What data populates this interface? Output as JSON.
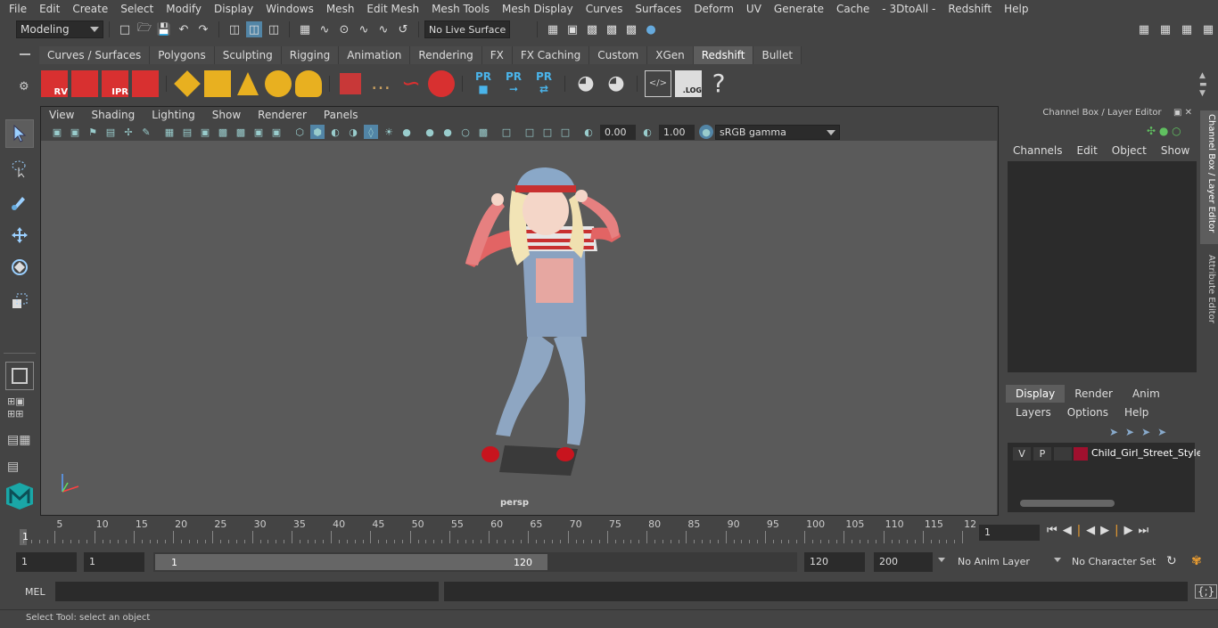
{
  "menu": [
    "File",
    "Edit",
    "Create",
    "Select",
    "Modify",
    "Display",
    "Windows",
    "Mesh",
    "Edit Mesh",
    "Mesh Tools",
    "Mesh Display",
    "Curves",
    "Surfaces",
    "Deform",
    "UV",
    "Generate",
    "Cache",
    "- 3DtoAll -",
    "Redshift",
    "Help"
  ],
  "status": {
    "mode": "Modeling",
    "live_surface": "No Live Surface"
  },
  "shelf": {
    "tabs": [
      "Curves / Surfaces",
      "Polygons",
      "Sculpting",
      "Rigging",
      "Animation",
      "Rendering",
      "FX",
      "FX Caching",
      "Custom",
      "XGen",
      "Redshift",
      "Bullet"
    ],
    "active_tab": "Redshift",
    "icons": {
      "rv": "RV",
      "ipr": "IPR",
      "pr1": "PR",
      "pr2": "PR",
      "pr3": "PR",
      "log": ".LOG",
      "help": "?"
    }
  },
  "viewport": {
    "menu": [
      "View",
      "Shading",
      "Lighting",
      "Show",
      "Renderer",
      "Panels"
    ],
    "exposure": "0.00",
    "gamma": "1.00",
    "color_space": "sRGB gamma",
    "camera_label": "persp"
  },
  "channel_box": {
    "title": "Channel Box / Layer Editor",
    "menu": [
      "Channels",
      "Edit",
      "Object",
      "Show"
    ],
    "layer_tabs": [
      "Display",
      "Render",
      "Anim"
    ],
    "active_layer_tab": "Display",
    "layer_menu": [
      "Layers",
      "Options",
      "Help"
    ],
    "layer": {
      "v": "V",
      "p": "P",
      "name": "Child_Girl_Street_Style",
      "color": "#a0102e"
    }
  },
  "side_tabs": {
    "channel_box": "Channel Box / Layer Editor",
    "attribute_editor": "Attribute Editor"
  },
  "timeline": {
    "ticks": [
      "5",
      "10",
      "15",
      "20",
      "25",
      "30",
      "35",
      "40",
      "45",
      "50",
      "55",
      "60",
      "65",
      "70",
      "75",
      "80",
      "85",
      "90",
      "95",
      "100",
      "105",
      "110",
      "115",
      "12"
    ],
    "current_frame_label": "1",
    "current_frame_field": "1"
  },
  "range": {
    "start": "1",
    "playback_start": "1",
    "slider_start": "1",
    "slider_end": "120",
    "end": "120",
    "anim_end": "200",
    "anim_layer": "No Anim Layer",
    "character_set": "No Character Set"
  },
  "command": {
    "label": "MEL"
  },
  "help_line": "Select Tool: select an object"
}
